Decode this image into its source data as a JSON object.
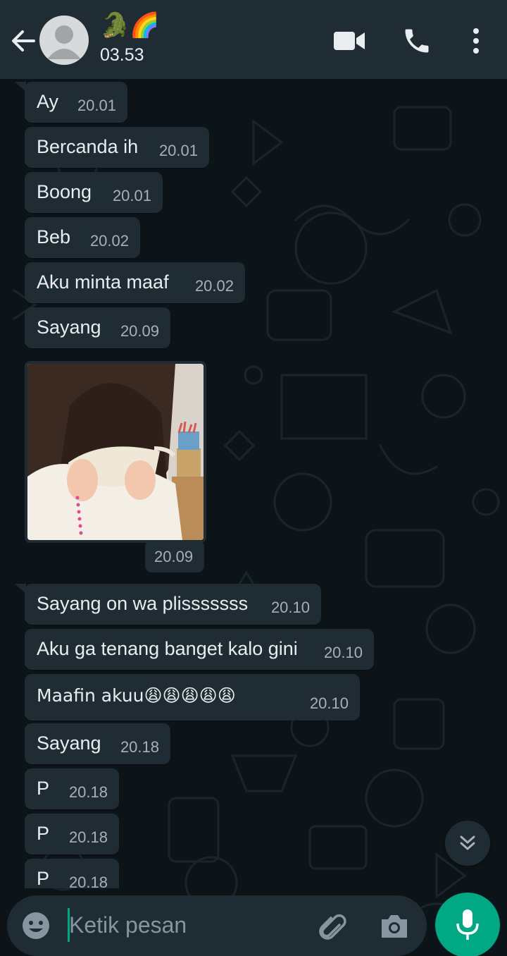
{
  "header": {
    "contact_name": "🐊🌈",
    "status": "03.53"
  },
  "messages": [
    {
      "text": "Ay",
      "time": "20.01"
    },
    {
      "text": "Bercanda ih",
      "time": "20.01"
    },
    {
      "text": "Boong",
      "time": "20.01"
    },
    {
      "text": "Beb",
      "time": "20.02"
    },
    {
      "text": "Aku minta maaf",
      "time": "20.02"
    },
    {
      "text": "Sayang",
      "time": "20.09"
    },
    {
      "image": "photo of crying child covering face with tissue",
      "time": "20.09"
    },
    {
      "text": "Sayang on wa plisssssss",
      "time": "20.10"
    },
    {
      "text": "Aku ga tenang banget kalo gini",
      "time": "20.10"
    },
    {
      "text": "Maafin akuu😩😩😩😩😩",
      "time": "20.10"
    },
    {
      "text": "Sayang",
      "time": "20.18"
    },
    {
      "text": "P",
      "time": "20.18"
    },
    {
      "text": "P",
      "time": "20.18"
    },
    {
      "text": "P",
      "time": "20.18"
    }
  ],
  "composer": {
    "placeholder": "Ketik pesan"
  },
  "icons": {
    "back": "arrow-left-icon",
    "video": "video-camera-icon",
    "call": "phone-icon",
    "menu": "more-vertical-icon",
    "emoji": "emoji-icon",
    "attach": "paperclip-icon",
    "camera": "camera-icon",
    "mic": "microphone-icon",
    "scroll": "double-chevron-down-icon"
  },
  "colors": {
    "header_bg": "#1f2c34",
    "bubble_bg": "#1f2c34",
    "accent": "#00a884",
    "chat_bg": "#0d1418"
  }
}
